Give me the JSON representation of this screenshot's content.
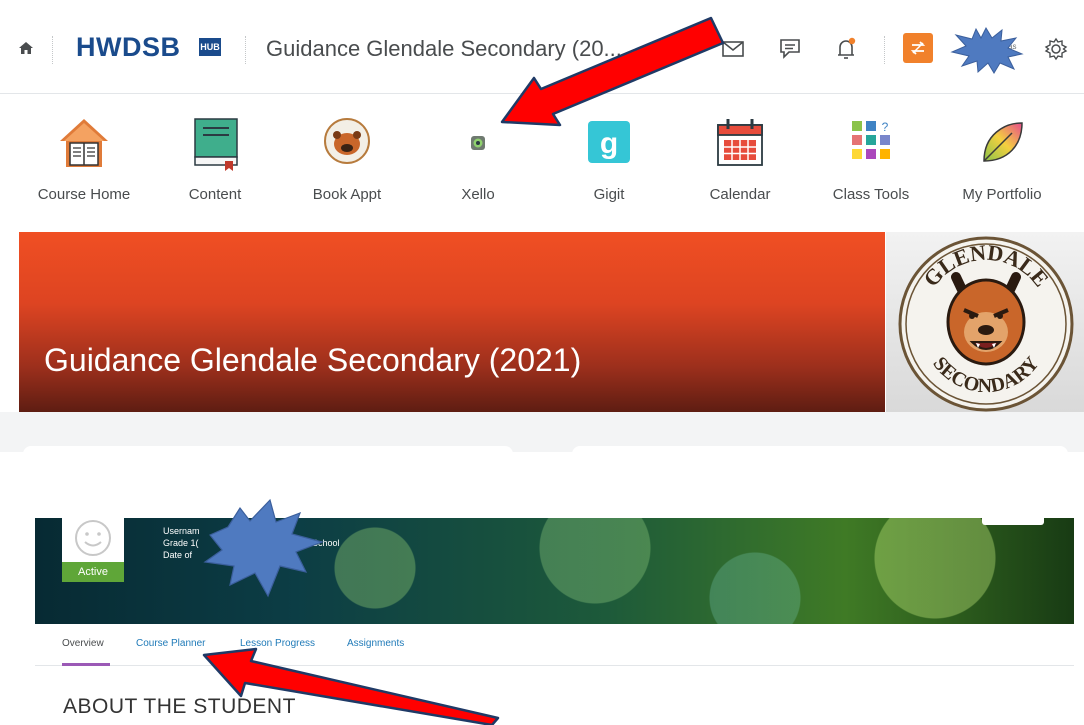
{
  "topbar": {
    "brand": "HWDSB",
    "hub_badge": "HUB",
    "course_title": "Guidance Glendale Secondary (20...",
    "user_fragment": "as"
  },
  "navbar": {
    "items": [
      {
        "label": "Course Home",
        "icon": "house-book-icon"
      },
      {
        "label": "Content",
        "icon": "book-icon"
      },
      {
        "label": "Book Appt",
        "icon": "bear-logo-icon"
      },
      {
        "label": "Xello",
        "icon": "xello-icon"
      },
      {
        "label": "Gigit",
        "icon": "gigit-icon"
      },
      {
        "label": "Calendar",
        "icon": "calendar-icon"
      },
      {
        "label": "Class Tools",
        "icon": "tools-grid-icon"
      },
      {
        "label": "My Portfolio",
        "icon": "leaf-icon"
      }
    ]
  },
  "banner": {
    "title": "Guidance Glendale Secondary (2021)",
    "logo_top": "GLENDALE",
    "logo_bottom": "SECONDARY"
  },
  "profile": {
    "username_line": "Usernam",
    "grade_line": "Grade 1(",
    "school_fragment": "ary School",
    "dob_line": "Date of",
    "status": "Active"
  },
  "tabs": [
    {
      "label": "Overview",
      "active": true
    },
    {
      "label": "Course Planner",
      "active": false
    },
    {
      "label": "Lesson Progress",
      "active": false
    },
    {
      "label": "Assignments",
      "active": false
    }
  ],
  "section": {
    "heading": "ABOUT THE STUDENT"
  },
  "colors": {
    "brand_blue": "#1a4b8c",
    "banner_orange": "#f04f23",
    "role_orange": "#f1812b",
    "annotation_red": "#ff0000",
    "burst_blue": "#4f7ac0",
    "active_green": "#5fa638",
    "tab_purple": "#9b59b6"
  }
}
